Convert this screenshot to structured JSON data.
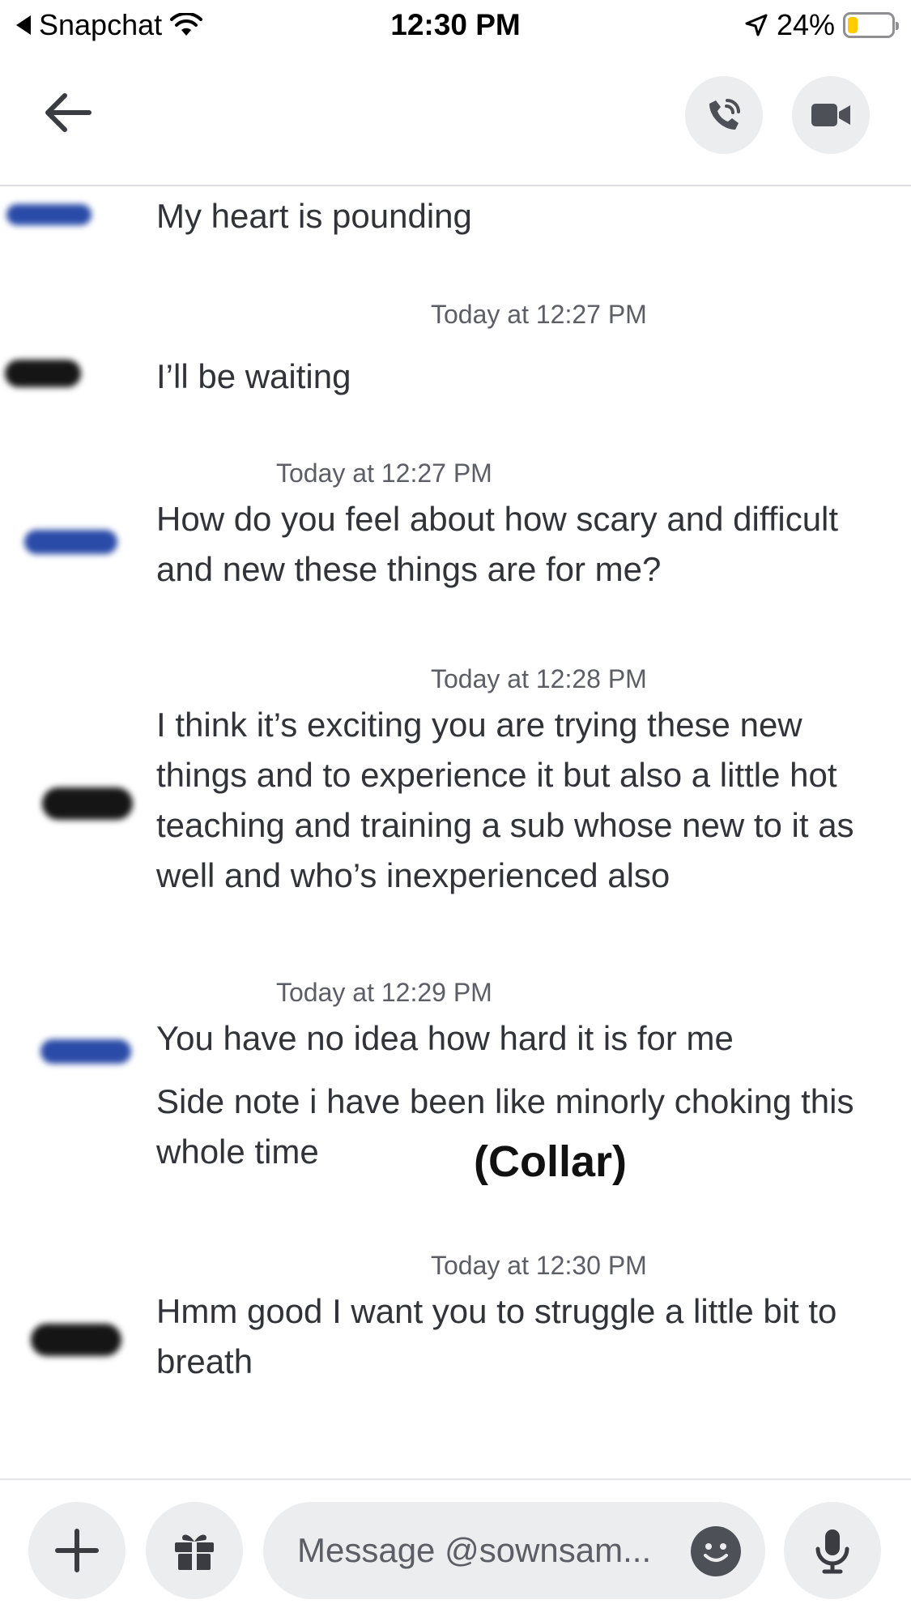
{
  "status_bar": {
    "back_app": "Snapchat",
    "time": "12:30 PM",
    "battery": "24%",
    "battery_level": 0.24,
    "battery_color": "#ffcc00"
  },
  "header": {
    "back_icon": "arrow-left-icon",
    "call_icon": "phone-call-icon",
    "video_icon": "video-camera-icon"
  },
  "messages": [
    {
      "timestamp": "",
      "text": "My heart is pounding",
      "sender_color": "blue"
    },
    {
      "timestamp": "Today at 12:27 PM",
      "text": "I’ll be waiting",
      "sender_color": "black"
    },
    {
      "timestamp": "Today at 12:27 PM",
      "text": "How do you feel about how scary and difficult and new these things are for me?",
      "sender_color": "blue"
    },
    {
      "timestamp": "Today at 12:28 PM",
      "text": "I think it’s exciting you are trying these new things and to experience it but also a little hot teaching and training a sub whose new to it as well and who’s inexperienced also",
      "sender_color": "black"
    },
    {
      "timestamp": "Today at 12:29 PM",
      "text": "You have no idea how hard it is for me",
      "text2": "Side note i have been like minorly choking this whole time",
      "annotation": "(Collar)",
      "sender_color": "blue"
    },
    {
      "timestamp": "Today at 12:30 PM",
      "text": "Hmm good I want you to struggle a little bit to breath",
      "sender_color": "black"
    }
  ],
  "composer": {
    "placeholder": "Message @sownsam...",
    "plus_icon": "plus-icon",
    "gift_icon": "gift-icon",
    "emoji_icon": "emoji-icon",
    "mic_icon": "microphone-icon"
  },
  "colors": {
    "smudge_blue": "#2a4ba8",
    "smudge_black": "#151515",
    "button_bg": "#ebedef"
  }
}
